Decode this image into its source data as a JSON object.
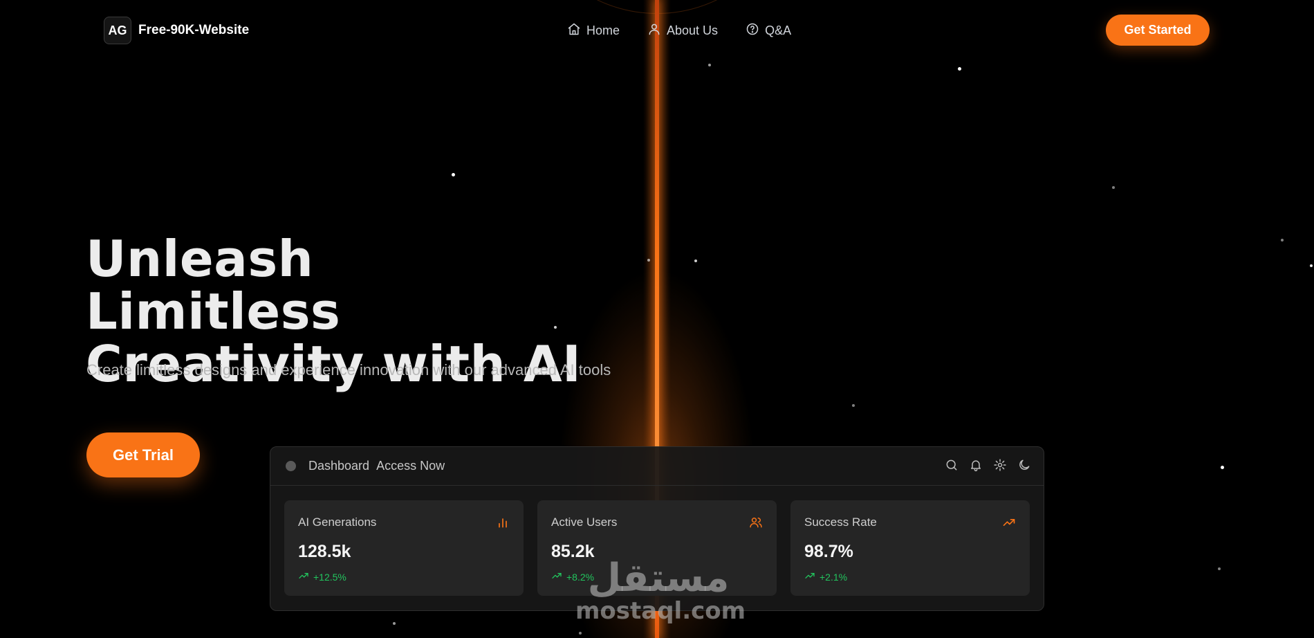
{
  "header": {
    "logo_mark": "AG",
    "site_name": "Free-90K-Website",
    "nav": [
      {
        "label": "Home",
        "icon": "home-icon"
      },
      {
        "label": "About Us",
        "icon": "user-icon"
      },
      {
        "label": "Q&A",
        "icon": "help-circle-icon"
      }
    ],
    "cta_label": "Get Started"
  },
  "hero": {
    "title_line1": "Unleash Limitless",
    "title_line2": "Creativity with AI",
    "subtitle": "Create limitless designs and experience innovation with our advanced AI tools",
    "cta_label": "Get Trial"
  },
  "dashboard": {
    "title": "Dashboard",
    "link": "Access Now",
    "toolbar_icons": [
      "search-icon",
      "bell-icon",
      "gear-icon",
      "moon-icon"
    ],
    "cards": [
      {
        "title": "AI Generations",
        "value": "128.5k",
        "change": "+12.5%",
        "icon": "bar-chart-icon"
      },
      {
        "title": "Active Users",
        "value": "85.2k",
        "change": "+8.2%",
        "icon": "users-icon"
      },
      {
        "title": "Success Rate",
        "value": "98.7%",
        "change": "+2.1%",
        "icon": "trending-up-icon"
      }
    ]
  },
  "watermark": {
    "arabic": "مستقل",
    "latin": "mostaql.com"
  },
  "colors": {
    "accent": "#f97316",
    "background": "#000000",
    "panel": "#181818",
    "card": "#252525",
    "positive": "#22c55e"
  }
}
